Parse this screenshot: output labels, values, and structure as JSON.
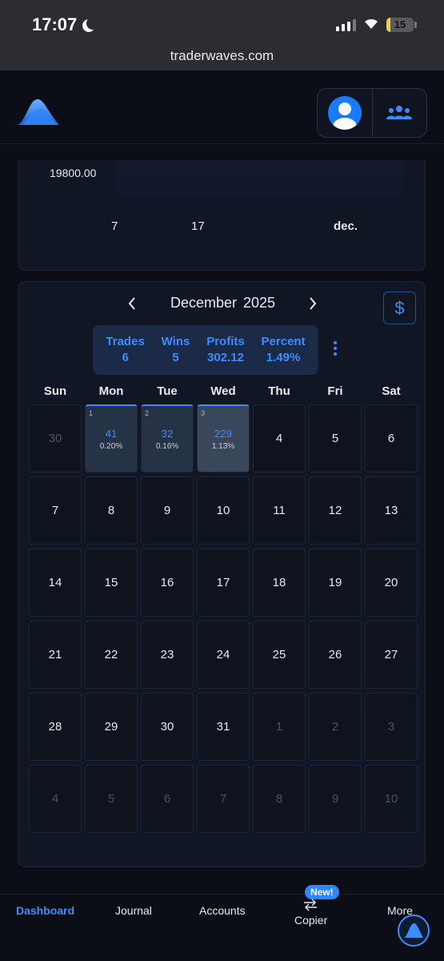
{
  "status_bar": {
    "time": "17:07",
    "battery": "15"
  },
  "browser": {
    "url": "traderwaves.com"
  },
  "chart_data": {
    "type": "area",
    "y_tick_labels": [
      "19800.00"
    ],
    "x_tick_labels": [
      "7",
      "17",
      "dec."
    ]
  },
  "calendar": {
    "month": "December",
    "year": "2025",
    "prev_icon": "chevron-left-icon",
    "next_icon": "chevron-right-icon",
    "currency_symbol": "$",
    "stats": [
      {
        "label": "Trades",
        "value": "6"
      },
      {
        "label": "Wins",
        "value": "5"
      },
      {
        "label": "Profits",
        "value": "302.12"
      },
      {
        "label": "Percent",
        "value": "1.49%"
      }
    ],
    "weekdays": [
      "Sun",
      "Mon",
      "Tue",
      "Wed",
      "Thu",
      "Fri",
      "Sat"
    ],
    "days": [
      {
        "label": "30",
        "muted": true
      },
      {
        "label": "1",
        "trade": true,
        "profit": "41",
        "percent": "0.20%"
      },
      {
        "label": "2",
        "trade": true,
        "profit": "32",
        "percent": "0.16%"
      },
      {
        "label": "3",
        "trade": true,
        "profit": "229",
        "percent": "1.13%",
        "highlight": true
      },
      {
        "label": "4"
      },
      {
        "label": "5"
      },
      {
        "label": "6"
      },
      {
        "label": "7"
      },
      {
        "label": "8"
      },
      {
        "label": "9"
      },
      {
        "label": "10"
      },
      {
        "label": "11"
      },
      {
        "label": "12"
      },
      {
        "label": "13"
      },
      {
        "label": "14"
      },
      {
        "label": "15"
      },
      {
        "label": "16"
      },
      {
        "label": "17"
      },
      {
        "label": "18"
      },
      {
        "label": "19"
      },
      {
        "label": "20"
      },
      {
        "label": "21"
      },
      {
        "label": "22"
      },
      {
        "label": "23"
      },
      {
        "label": "24"
      },
      {
        "label": "25"
      },
      {
        "label": "26"
      },
      {
        "label": "27"
      },
      {
        "label": "28"
      },
      {
        "label": "29"
      },
      {
        "label": "30"
      },
      {
        "label": "31"
      },
      {
        "label": "1",
        "muted": true
      },
      {
        "label": "2",
        "muted": true
      },
      {
        "label": "3",
        "muted": true
      },
      {
        "label": "4",
        "muted": true
      },
      {
        "label": "5",
        "muted": true
      },
      {
        "label": "6",
        "muted": true
      },
      {
        "label": "7",
        "muted": true
      },
      {
        "label": "8",
        "muted": true
      },
      {
        "label": "9",
        "muted": true
      },
      {
        "label": "10",
        "muted": true
      }
    ]
  },
  "bottom_nav": {
    "items": [
      "Dashboard",
      "Journal",
      "Accounts",
      "Copier",
      "More"
    ],
    "active": "Dashboard",
    "new_badge": "New!"
  },
  "colors": {
    "accent": "#3d8bff",
    "background": "#0b0e17",
    "card": "#111624"
  }
}
